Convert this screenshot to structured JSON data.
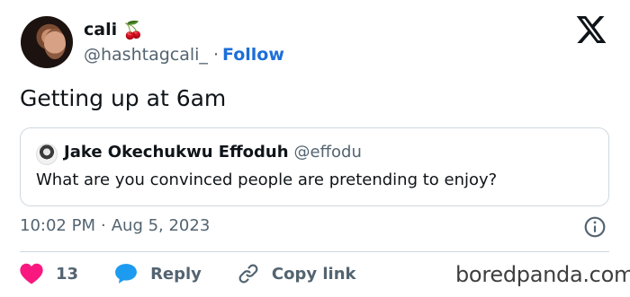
{
  "author": {
    "display_name": "cali",
    "emoji": "🍒",
    "handle": "@hashtagcali_",
    "separator": "·",
    "follow_label": "Follow"
  },
  "tweet": {
    "text": "Getting up at 6am",
    "time": "10:02 PM",
    "separator": "·",
    "date": "Aug 5, 2023"
  },
  "quote": {
    "name": "Jake Okechukwu Effoduh",
    "handle": "@effodu",
    "text": "What are you convinced people are pretending to enjoy?"
  },
  "actions": {
    "like_count": "13",
    "reply_label": "Reply",
    "copy_label": "Copy link"
  },
  "icons": {
    "platform_logo": "x-logo-icon",
    "info": "info-icon",
    "like": "heart-icon",
    "reply": "speech-bubble-icon",
    "copy": "link-icon"
  },
  "colors": {
    "follow": "#1d6fd8",
    "like": "#f91880",
    "reply": "#1d9bf0",
    "secondary_text": "#536471"
  },
  "watermark": "boredpanda.com"
}
